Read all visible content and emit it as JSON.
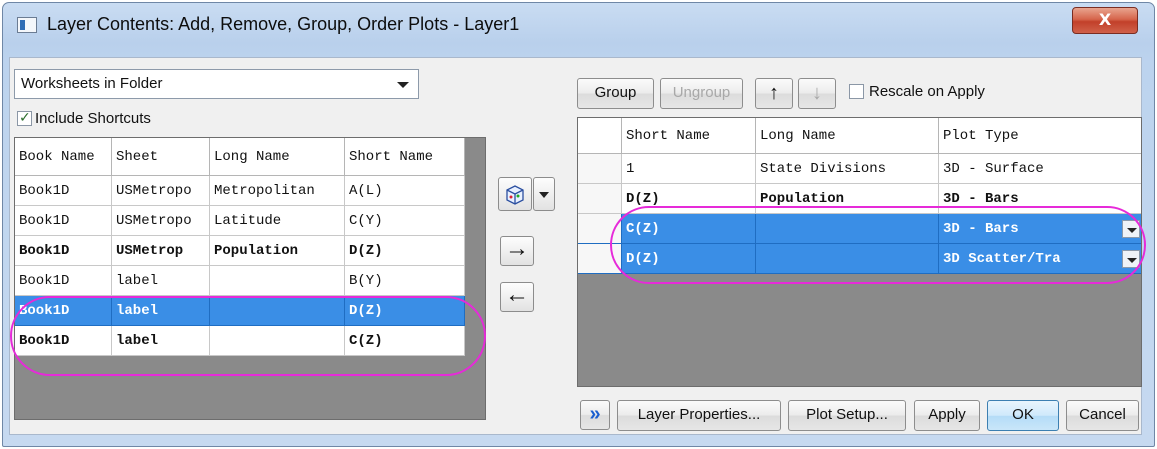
{
  "window": {
    "title": "Layer Contents: Add, Remove, Group, Order Plots - Layer1",
    "close_label": "X"
  },
  "left": {
    "source_combo": "Worksheets in Folder",
    "include_shortcuts": {
      "label": "Include Shortcuts",
      "checked": true
    },
    "columns": [
      "Book Name",
      "Sheet",
      "Long Name",
      "Short Name"
    ],
    "rows": [
      {
        "book": "Book1D",
        "sheet": "USMetropo",
        "long": "Metropolitan",
        "short": "A(L)",
        "style": "normal"
      },
      {
        "book": "Book1D",
        "sheet": "USMetropo",
        "long": "Latitude",
        "short": "C(Y)",
        "style": "normal"
      },
      {
        "book": "Book1D",
        "sheet": "USMetrop",
        "long": "Population",
        "short": "D(Z)",
        "style": "bold"
      },
      {
        "book": "Book1D",
        "sheet": "label",
        "long": "",
        "short": "B(Y)",
        "style": "normal"
      },
      {
        "book": "Book1D",
        "sheet": "label",
        "long": "",
        "short": "D(Z)",
        "style": "selected"
      },
      {
        "book": "Book1D",
        "sheet": "label",
        "long": "",
        "short": "C(Z)",
        "style": "bold"
      }
    ]
  },
  "toolbar": {
    "group_label": "Group",
    "ungroup_label": "Ungroup",
    "up_icon": "arrow-up-icon",
    "down_icon": "arrow-down-icon",
    "rescale_label": "Rescale on Apply",
    "rescale_checked": false
  },
  "right": {
    "columns": [
      "",
      "Short Name",
      "Long Name",
      "Plot Type"
    ],
    "rows": [
      {
        "short": "1",
        "long": "State Divisions",
        "type": "3D - Surface",
        "style": "normal"
      },
      {
        "short": "D(Z)",
        "long": "Population",
        "type": "3D - Bars",
        "style": "bold"
      },
      {
        "short": "C(Z)",
        "long": "",
        "type": "3D - Bars",
        "style": "selected"
      },
      {
        "short": "D(Z)",
        "long": "",
        "type": "3D Scatter/Tra",
        "style": "selected"
      }
    ]
  },
  "footer": {
    "expand_label": "»",
    "layer_props_label": "Layer Properties...",
    "plot_setup_label": "Plot Setup...",
    "apply_label": "Apply",
    "ok_label": "OK",
    "cancel_label": "Cancel"
  },
  "colors": {
    "selection": "#3a8ee6",
    "highlight": "#e62ad9"
  }
}
